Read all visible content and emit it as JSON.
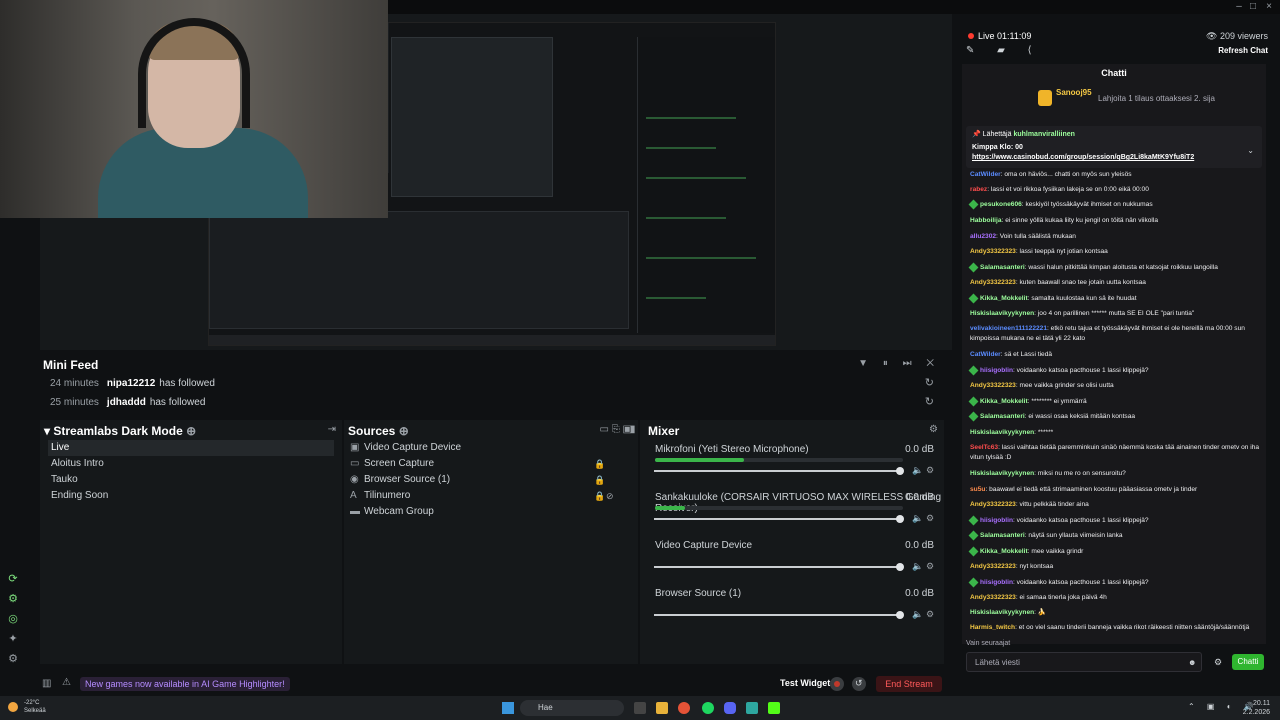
{
  "window": {
    "minimize": "–",
    "maximize": "□",
    "close": "×"
  },
  "minifeed": {
    "title": "Mini Feed",
    "events": [
      {
        "time": "24 minutes",
        "user": "nipa12212",
        "action": "has followed"
      },
      {
        "time": "25 minutes",
        "user": "jdhaddd",
        "action": "has followed"
      }
    ]
  },
  "scenes": {
    "title": "Streamlabs Dark Mode",
    "items": [
      "Live",
      "Aloitus Intro",
      "Tauko",
      "Ending Soon"
    ],
    "active": "Live"
  },
  "sources": {
    "title": "Sources",
    "items": [
      {
        "label": "Video Capture Device",
        "icon": "camera-icon"
      },
      {
        "label": "Screen Capture",
        "icon": "screen-icon"
      },
      {
        "label": "Browser Source (1)",
        "icon": "globe-icon"
      },
      {
        "label": "Tilinumero",
        "icon": "text-icon"
      },
      {
        "label": "Webcam Group",
        "icon": "folder-icon"
      }
    ]
  },
  "mixer": {
    "title": "Mixer",
    "channels": [
      {
        "label": "Mikrofoni (Yeti Stereo Microphone)",
        "db": "0.0 dB",
        "level": 0.36
      },
      {
        "label": "Sankakuuloke (CORSAIR VIRTUOSO MAX WIRELESS Gaming Receiver)",
        "db": "0.0 dB",
        "level": 0.12
      },
      {
        "label": "Video Capture Device",
        "db": "0.0 dB",
        "level": 0
      },
      {
        "label": "Browser Source (1)",
        "db": "0.0 dB",
        "level": 0
      }
    ]
  },
  "statusbar": {
    "notification": "New games now available in AI Game Highlighter!",
    "test_widgets": "Test Widgets",
    "end_stream": "End Stream"
  },
  "chat": {
    "live": "Live 01:11:09",
    "viewers": "209 viewers",
    "refresh": "Refresh Chat",
    "title": "Chatti",
    "gift_user": "Sanooj95",
    "gift_text": "Lahjoita 1 tilaus ottaaksesi 2. sija",
    "pinned_by_label": "Lähettäjä",
    "pinned_by": "kuhlmanviralliinen",
    "pinned_msg": "Kimppa Klo: 00",
    "pinned_link": "https://www.casinobud.com/group/session/qBg2Li8kaMtK9Yfu8iT2",
    "messages": [
      {
        "user": "CatWilder",
        "color": "#5b8cff",
        "badge": false,
        "text": "oma on häviös... chatti on myös sun yleisös"
      },
      {
        "user": "rabez",
        "color": "#ff4d4d",
        "badge": false,
        "text": "lassi et voi rikkoa fysiikan lakeja se on 0:00 eikä 00:00"
      },
      {
        "user": "pesukone606",
        "color": "#9dff9d",
        "badge": true,
        "text": "keskiyöl työssäkäyvät ihmiset on nukkumas"
      },
      {
        "user": "Habboilija",
        "color": "#9dff9d",
        "badge": false,
        "text": "ei sinne yöllä kukaa liity ku jengil on töitä nän viikolla"
      },
      {
        "user": "allu2302",
        "color": "#a970ff",
        "badge": false,
        "text": "Voin tulla säälistä mukaan"
      },
      {
        "user": "Andy33322323",
        "color": "#f5c945",
        "badge": false,
        "text": "lassi teeppä nyt jotian kontsaa"
      },
      {
        "user": "Salamasanteri",
        "color": "#9dff9d",
        "badge": true,
        "text": "wassi halun pitkittää kimpan aloitusta et katsojat roikkuu langoilla"
      },
      {
        "user": "Andy33322323",
        "color": "#f5c945",
        "badge": false,
        "text": "kuten baawall snao tee jotain uutta kontsaa"
      },
      {
        "user": "Kikka_Mokkelit",
        "color": "#9dff9d",
        "badge": true,
        "text": "samalta kuulostaa kun sä ite huudat"
      },
      {
        "user": "Hiskislaavikyykynen",
        "color": "#9dff9d",
        "badge": false,
        "text": "joo 4 on parillinen ****** mutta SE EI OLE \"pari tuntia\""
      },
      {
        "user": "velivakioineen111122221",
        "color": "#5b8cff",
        "badge": false,
        "text": "etkö retu tajua et työssäkäyvät ihmiset ei ole hereillä ma 00:00 sun kimpoissa mukana ne ei tätä yli 22 kato"
      },
      {
        "user": "CatWilder",
        "color": "#5b8cff",
        "badge": false,
        "text": "sä et Lassi tiedä"
      },
      {
        "user": "hiisigoblin",
        "color": "#a970ff",
        "badge": true,
        "text": "voidaanko katsoa pacthouse 1 lassi klippejä?"
      },
      {
        "user": "Andy33322323",
        "color": "#f5c945",
        "badge": false,
        "text": "mee vaikka grinder se olisi uutta"
      },
      {
        "user": "Kikka_Mokkelit",
        "color": "#9dff9d",
        "badge": true,
        "text": "******** ei ymmärrä"
      },
      {
        "user": "Salamasanteri",
        "color": "#9dff9d",
        "badge": true,
        "text": "ei wassi osaa keksiä mitään kontsaa"
      },
      {
        "user": "Hiskislaavikyykynen",
        "color": "#9dff9d",
        "badge": false,
        "text": "******"
      },
      {
        "user": "SeelTc63",
        "color": "#ff4d4d",
        "badge": false,
        "text": "lassi vaihtaa tietää paremminkuin sinäö näemmä koska tää ainainen tinder ometv on iha vitun tylsää :D"
      },
      {
        "user": "Hiskislaavikyykynen",
        "color": "#9dff9d",
        "badge": false,
        "text": "miksi nu me ro on sensuroitu?"
      },
      {
        "user": "su5u",
        "color": "#ff8c4d",
        "badge": false,
        "text": "baawawl ei tiedä että strimaaminen koostuu pääasiassa ometv ja tinder"
      },
      {
        "user": "Andy33322323",
        "color": "#f5c945",
        "badge": false,
        "text": "vittu pelkkää tinder aina"
      },
      {
        "user": "hiisigoblin",
        "color": "#a970ff",
        "badge": true,
        "text": "voidaanko katsoa pacthouse 1 lassi klippejä?"
      },
      {
        "user": "Salamasanteri",
        "color": "#9dff9d",
        "badge": true,
        "text": "näytä sun yllauta viimeisin lanka"
      },
      {
        "user": "Kikka_Mokkelit",
        "color": "#9dff9d",
        "badge": true,
        "text": "mee vaikka grindr"
      },
      {
        "user": "Andy33322323",
        "color": "#f5c945",
        "badge": false,
        "text": "nyt kontsaa"
      },
      {
        "user": "hiisigoblin",
        "color": "#a970ff",
        "badge": true,
        "text": "voidaanko katsoa pacthouse 1 lassi klippejä?"
      },
      {
        "user": "Andy33322323",
        "color": "#f5c945",
        "badge": false,
        "text": "ei samaa tinerla joka päivä 4h"
      },
      {
        "user": "Hiskislaavikyykynen",
        "color": "#9dff9d",
        "badge": false,
        "text": "🍌"
      },
      {
        "user": "Harmis_twitch",
        "color": "#f5c945",
        "badge": false,
        "text": "et oo viel saanu tinderii banneja vaikka rikot räikeesti niitten sääntöjä/säännötjä"
      }
    ],
    "followers_only": "Vain seuraajat",
    "input_placeholder": "Lähetä viesti",
    "send": "Chatti"
  },
  "taskbar": {
    "weather_temp": "-22°C",
    "weather_desc": "Selkeää",
    "search": "Hae",
    "time": "20.11",
    "date": "2.2.2026"
  }
}
